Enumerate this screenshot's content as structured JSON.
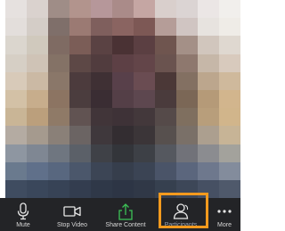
{
  "video": {
    "palette_rows": [
      [
        "#e6e1df",
        "#dad2ce",
        "#9f8d87",
        "#b2948d",
        "#b6979a",
        "#aa8b89",
        "#c5a6a3",
        "#d9cfcc",
        "#dbd4d3",
        "#ebe6e5",
        "#f1efec"
      ],
      [
        "#e3dedb",
        "#d4cdc7",
        "#7f6f6a",
        "#9b7a73",
        "#7f5f5d",
        "#8a6461",
        "#7d5855",
        "#b59d98",
        "#d0c5c2",
        "#e7e3df",
        "#efece7"
      ],
      [
        "#dbd6ce",
        "#d0c9bd",
        "#7f6b63",
        "#7b5d57",
        "#5a4243",
        "#4a3234",
        "#5b3f42",
        "#6f554f",
        "#a49087",
        "#d1c6bd",
        "#dfd8d0"
      ],
      [
        "#d6cfc5",
        "#cfc3b6",
        "#847266",
        "#5d4846",
        "#513c3e",
        "#5d4045",
        "#634549",
        "#6a534f",
        "#8e786e",
        "#c6b7a8",
        "#d8cabd"
      ],
      [
        "#d8cab9",
        "#cbb9a4",
        "#8a7769",
        "#4c3b3d",
        "#3f3034",
        "#58404a",
        "#6a4c52",
        "#4b3837",
        "#837062",
        "#bca68d",
        "#cfb99c"
      ],
      [
        "#d3c1a6",
        "#c7ad8c",
        "#8c7462",
        "#4b3d3e",
        "#3a2d33",
        "#543f47",
        "#5d474f",
        "#4a3b3c",
        "#7b6756",
        "#b59a78",
        "#d2b58d"
      ],
      [
        "#c9b596",
        "#bb9f7c",
        "#8f7a67",
        "#615352",
        "#413539",
        "#3e3237",
        "#43383b",
        "#554a49",
        "#7f6f5f",
        "#b89e7b",
        "#d1b58b"
      ],
      [
        "#b4aba2",
        "#a59a8e",
        "#8a8078",
        "#6b6463",
        "#3f383c",
        "#332d31",
        "#3b3538",
        "#57504e",
        "#7a7068",
        "#ac9f8f",
        "#c7b496"
      ],
      [
        "#8e96a1",
        "#7f8793",
        "#6f7680",
        "#5b6068",
        "#3f4147",
        "#33353a",
        "#3d4046",
        "#55585f",
        "#717279",
        "#8b8c90",
        "#a3a29c"
      ],
      [
        "#6a7a8e",
        "#60708a",
        "#58677f",
        "#4b576b",
        "#3c4555",
        "#363e4c",
        "#3b4454",
        "#4a5468",
        "#5b667d",
        "#6e788d",
        "#838c9c"
      ],
      [
        "#3f4c60",
        "#3a475b",
        "#374356",
        "#333d4f",
        "#2f3848",
        "#2d3545",
        "#303847",
        "#36404f",
        "#3d4758",
        "#465063",
        "#4f596b"
      ]
    ]
  },
  "toolbar": {
    "items": [
      {
        "label": "Mute",
        "icon": "microphone-icon"
      },
      {
        "label": "Stop Video",
        "icon": "video-camera-icon"
      },
      {
        "label": "Share Content",
        "icon": "share-upload-icon"
      },
      {
        "label": "Participants",
        "icon": "participants-icon"
      },
      {
        "label": "More",
        "icon": "more-dots-icon"
      }
    ],
    "accent_color": "#f39a1e",
    "share_icon_color": "#3cc256"
  }
}
